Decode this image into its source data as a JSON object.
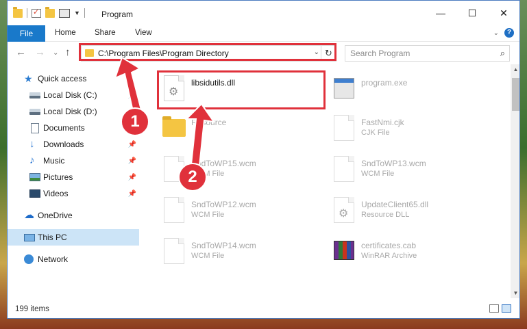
{
  "window": {
    "title": "Program"
  },
  "ribbon": {
    "file": "File",
    "home": "Home",
    "share": "Share",
    "view": "View"
  },
  "address": {
    "path": "C:\\Program Files\\Program Directory"
  },
  "search": {
    "placeholder": "Search Program"
  },
  "sidebar": {
    "items": [
      {
        "label": "Quick access",
        "icon": "star-icon"
      },
      {
        "label": "Local Disk (C:)",
        "icon": "disk-icon"
      },
      {
        "label": "Local Disk (D:)",
        "icon": "disk-icon"
      },
      {
        "label": "Documents",
        "icon": "documents-icon"
      },
      {
        "label": "Downloads",
        "icon": "downloads-icon"
      },
      {
        "label": "Music",
        "icon": "music-icon"
      },
      {
        "label": "Pictures",
        "icon": "pictures-icon"
      },
      {
        "label": "Videos",
        "icon": "videos-icon"
      },
      {
        "label": "OneDrive",
        "icon": "onedrive-icon"
      },
      {
        "label": "This PC",
        "icon": "pc-icon"
      },
      {
        "label": "Network",
        "icon": "network-icon"
      }
    ]
  },
  "files": [
    {
      "name": "libsidutils.dll",
      "type": ""
    },
    {
      "name": "program.exe",
      "type": ""
    },
    {
      "name": "Resource",
      "type": ""
    },
    {
      "name": "FastNmi.cjk",
      "type": "CJK File"
    },
    {
      "name": "SndToWP15.wcm",
      "type": "WCM File"
    },
    {
      "name": "SndToWP13.wcm",
      "type": "WCM File"
    },
    {
      "name": "SndToWP12.wcm",
      "type": "WCM File"
    },
    {
      "name": "UpdateClient65.dll",
      "type": "Resource DLL"
    },
    {
      "name": "SndToWP14.wcm",
      "type": "WCM File"
    },
    {
      "name": "certificates.cab",
      "type": "WinRAR Archive"
    }
  ],
  "status": {
    "count": "199 items"
  },
  "annotations": {
    "step1": "1",
    "step2": "2"
  },
  "colors": {
    "accent": "#1979ca",
    "highlight": "#e0313b",
    "selection": "#cce4f7"
  }
}
